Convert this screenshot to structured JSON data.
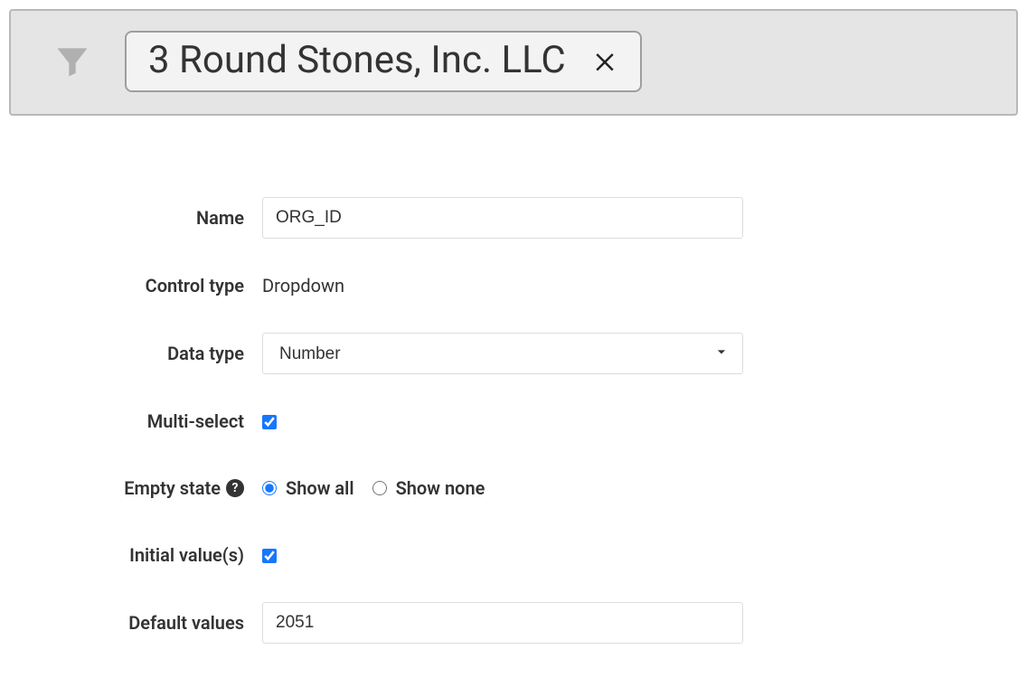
{
  "filter": {
    "chip_text": "3 Round Stones, Inc. LLC"
  },
  "form": {
    "name": {
      "label": "Name",
      "value": "ORG_ID"
    },
    "control_type": {
      "label": "Control type",
      "value": "Dropdown"
    },
    "data_type": {
      "label": "Data type",
      "value": "Number"
    },
    "multi_select": {
      "label": "Multi-select"
    },
    "empty_state": {
      "label": "Empty state",
      "option_all": "Show all",
      "option_none": "Show none"
    },
    "initial_values": {
      "label": "Initial value(s)"
    },
    "default_values": {
      "label": "Default values",
      "value": "2051"
    }
  }
}
